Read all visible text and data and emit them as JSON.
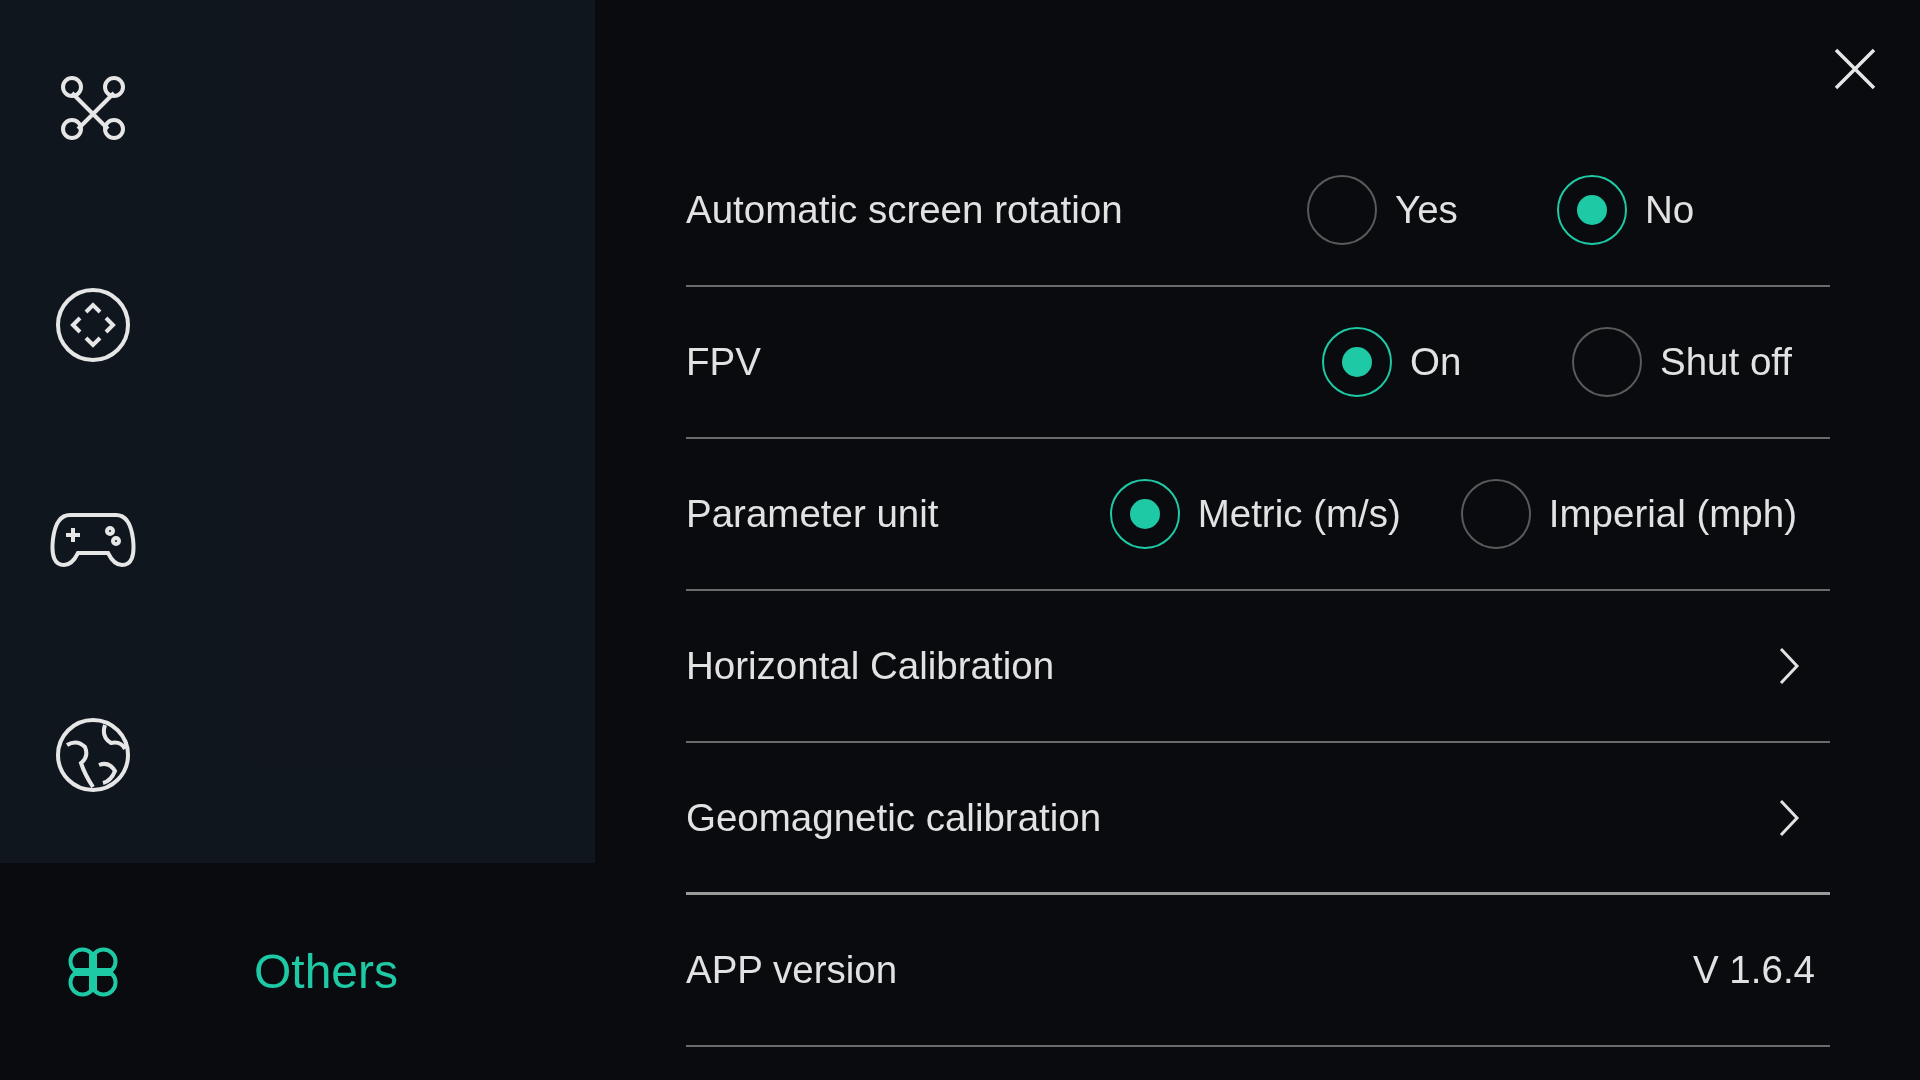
{
  "sidebar": {
    "items": [
      {
        "selected": false
      },
      {
        "selected": false
      },
      {
        "selected": false
      },
      {
        "selected": false
      },
      {
        "label": "Others",
        "selected": true
      }
    ]
  },
  "settings": [
    {
      "kind": "radio",
      "label": "Automatic screen rotation",
      "options": [
        {
          "label": "Yes",
          "selected": false
        },
        {
          "label": "No",
          "selected": true
        }
      ]
    },
    {
      "kind": "radio",
      "label": "FPV",
      "options": [
        {
          "label": "On",
          "selected": true
        },
        {
          "label": "Shut off",
          "selected": false
        }
      ]
    },
    {
      "kind": "radio",
      "label": "Parameter unit",
      "options": [
        {
          "label": "Metric (m/s)",
          "selected": true
        },
        {
          "label": "Imperial (mph)",
          "selected": false
        }
      ]
    },
    {
      "kind": "link",
      "label": "Horizontal Calibration"
    },
    {
      "kind": "link",
      "label": "Geomagnetic calibration"
    },
    {
      "kind": "info",
      "label": "APP version",
      "value": "V 1.6.4"
    }
  ]
}
